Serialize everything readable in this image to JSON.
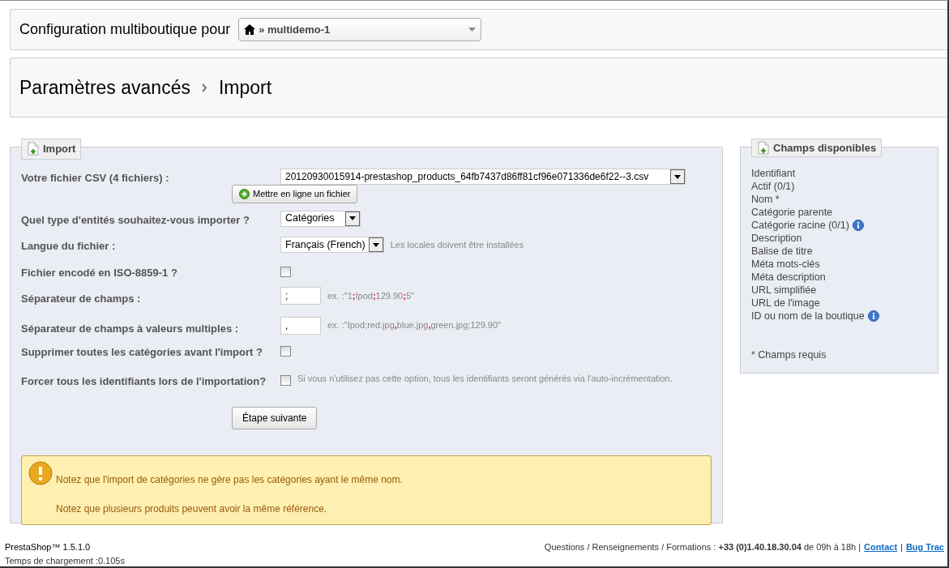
{
  "shop_bar": {
    "label": "Configuration multiboutique pour",
    "shop_select": {
      "value": "» multidemo-1"
    }
  },
  "breadcrumb": [
    {
      "label": "Paramètres avancés"
    },
    {
      "label": "Import"
    }
  ],
  "import_panel": {
    "title": "Import",
    "fields": [
      {
        "kind": "file",
        "label": "Votre fichier CSV (4 fichiers) :",
        "value": "20120930015914-prestashop_products_64fb7437d86ff81cf96e071336de6f22--3.csv",
        "upload_button": "Mettre en ligne un fichier"
      },
      {
        "kind": "select",
        "label": "Quel type d'entités souhaitez-vous importer ?",
        "value": "Catégories"
      },
      {
        "kind": "select",
        "label": "Langue du fichier :",
        "value": "Français (French)",
        "hint": [
          {
            "text": "Les locales doivent être installées",
            "highlight": false
          }
        ]
      },
      {
        "kind": "checkbox",
        "label": "Fichier encodé en ISO-8859-1 ?",
        "checked": false
      },
      {
        "kind": "text",
        "label": "Séparateur de champs :",
        "value": ";",
        "hint": [
          {
            "text": "ex. :\"1",
            "highlight": false
          },
          {
            "text": ";",
            "highlight": true
          },
          {
            "text": "Ipod",
            "highlight": false
          },
          {
            "text": ";",
            "highlight": true
          },
          {
            "text": "129.90",
            "highlight": false
          },
          {
            "text": ";",
            "highlight": true
          },
          {
            "text": "5\"",
            "highlight": false
          }
        ]
      },
      {
        "kind": "text",
        "label": "Séparateur de champs à valeurs multiples :",
        "value": ",",
        "hint": [
          {
            "text": "ex. :\"Ipod;red.jpg",
            "highlight": false
          },
          {
            "text": ",",
            "highlight": true
          },
          {
            "text": "blue.jpg",
            "highlight": false
          },
          {
            "text": ",",
            "highlight": true
          },
          {
            "text": "green.jpg;129.90\"",
            "highlight": false
          }
        ]
      },
      {
        "kind": "checkbox",
        "label": "Supprimer toutes les catégories avant l'import ?",
        "checked": false
      },
      {
        "kind": "checkbox",
        "label": "Forcer tous les identifiants lors de l'importation?",
        "checked": false,
        "hint": [
          {
            "text": "Si vous n'utilisez pas cette option, tous les identifiants seront générés via l'auto-incrémentation.",
            "highlight": false
          }
        ]
      }
    ],
    "next_button": "Étape suivante",
    "warnings": [
      "Notez que l'import de catégories ne gère pas les catégories ayant le même nom.",
      "Notez que plusieurs produits peuvent avoir la même référence."
    ]
  },
  "fields_panel": {
    "title": "Champs disponibles",
    "items": [
      {
        "label": "Identifiant",
        "info": false
      },
      {
        "label": "Actif (0/1)",
        "info": false
      },
      {
        "label": "Nom *",
        "info": false
      },
      {
        "label": "Catégorie parente",
        "info": false
      },
      {
        "label": "Catégorie racine (0/1)",
        "info": true
      },
      {
        "label": "Description",
        "info": false
      },
      {
        "label": "Balise de titre",
        "info": false
      },
      {
        "label": "Méta mots-clés",
        "info": false
      },
      {
        "label": "Méta description",
        "info": false
      },
      {
        "label": "URL simplifiée",
        "info": false
      },
      {
        "label": "URL de l'image",
        "info": false
      },
      {
        "label": "ID ou nom de la boutique",
        "info": true
      }
    ],
    "note": "* Champs requis"
  },
  "footer": {
    "version": "PrestaShop™ 1.5.1.0",
    "load_time": "Temps de chargement :0.105s",
    "contact_text": "Questions / Renseignements / Formations : **+33 (0)1.40.18.30.04** de 09h à 18h |",
    "links": [
      "Contact",
      "Bug Trac"
    ],
    "link_separator": "|"
  }
}
